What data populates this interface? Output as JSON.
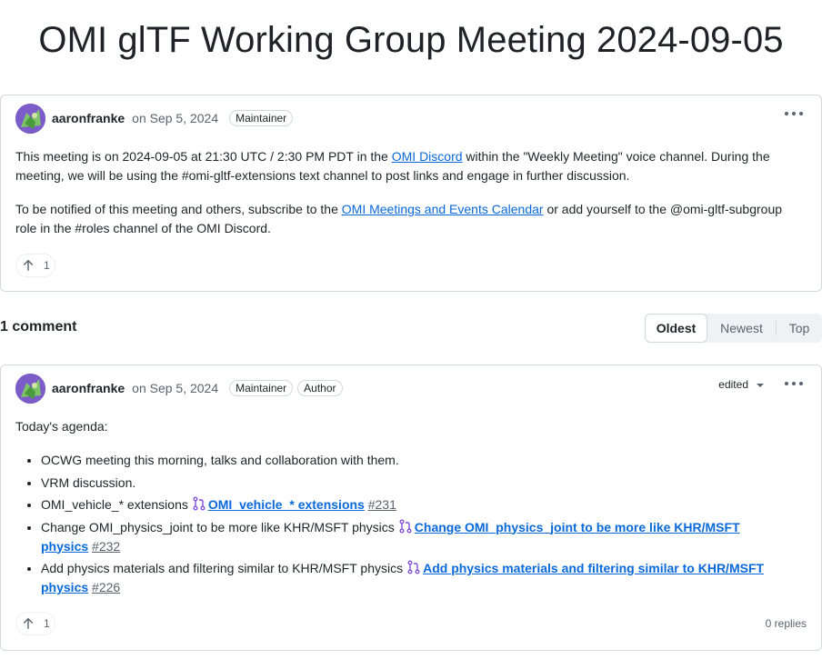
{
  "page": {
    "title": "OMI glTF Working Group Meeting 2024-09-05"
  },
  "discussion": {
    "author": "aaronfranke",
    "date": "on Sep 5, 2024",
    "badges": [
      "Maintainer"
    ],
    "para1_before": "This meeting is on 2024-09-05 at 21:30 UTC / 2:30 PM PDT in the ",
    "para1_link": "OMI Discord",
    "para1_after": " within the \"Weekly Meeting\" voice channel. During the meeting, we will be using the #omi-gltf-extensions text channel to post links and engage in further discussion.",
    "para2_before": "To be notified of this meeting and others, subscribe to the ",
    "para2_link": "OMI Meetings and Events Calendar",
    "para2_after": " or add yourself to the @omi-gltf-subgroup role in the #roles channel of the OMI Discord.",
    "reaction_count": "1"
  },
  "comments": {
    "count_label": "1 comment",
    "sort": {
      "oldest": "Oldest",
      "newest": "Newest",
      "top": "Top",
      "selected": "Oldest"
    }
  },
  "comment": {
    "author": "aaronfranke",
    "date": "on Sep 5, 2024",
    "badges": [
      "Maintainer",
      "Author"
    ],
    "edited_label": "edited",
    "intro": "Today's agenda:",
    "items": [
      {
        "text": "OCWG meeting this morning, talks and collaboration with them."
      },
      {
        "text": "VRM discussion."
      },
      {
        "text": "OMI_vehicle_* extensions",
        "pr_title": "OMI_vehicle_* extensions",
        "pr_number": "#231"
      },
      {
        "text": "Change OMI_physics_joint to be more like KHR/MSFT physics",
        "pr_title": "Change OMI_physics_joint to be more like KHR/MSFT physics",
        "pr_number": "#232"
      },
      {
        "text": "Add physics materials and filtering similar to KHR/MSFT physics",
        "pr_title": "Add physics materials and filtering similar to KHR/MSFT physics",
        "pr_number": "#226"
      }
    ],
    "reaction_count": "1",
    "replies_label": "0 replies"
  },
  "icons": {
    "avatar": "avatar-icon",
    "more": "kebab-horizontal-icon",
    "reaction": "arrow-up-icon",
    "pull_request": "git-pull-request-icon",
    "caret": "triangle-down-icon"
  },
  "colors": {
    "link": "#0969da",
    "pr_icon": "#8250df",
    "muted": "#59636e",
    "border": "#d1d9e0"
  }
}
